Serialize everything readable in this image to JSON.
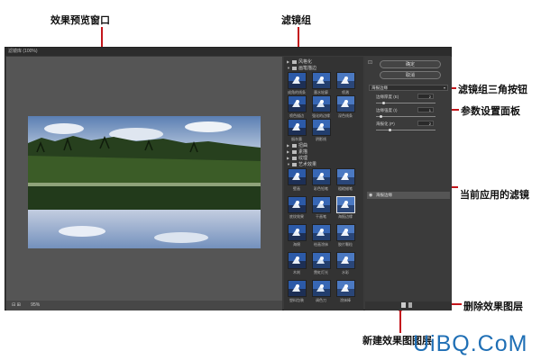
{
  "annotations": {
    "preview_window": "效果预览窗口",
    "filter_groups": "滤镜组",
    "group_triangle_button": "滤镜组三角按钮",
    "param_panel": "参数设置面板",
    "current_filter": "当前应用的滤镜",
    "delete_layer": "删除效果图层",
    "new_layer": "新建效果图图层"
  },
  "watermark": "UiBQ.CoM",
  "dialog": {
    "title": "滤镜库 (100%)",
    "zoom": "95%",
    "groups": [
      {
        "label": "风格化",
        "expanded": false
      },
      {
        "label": "画笔描边",
        "expanded": true
      },
      {
        "label": "扭曲",
        "expanded": false
      },
      {
        "label": "素描",
        "expanded": false
      },
      {
        "label": "纹理",
        "expanded": false
      },
      {
        "label": "艺术效果",
        "expanded": true
      }
    ],
    "brush_filters": [
      "成角的线条",
      "墨水轮廓",
      "喷溅",
      "喷色描边",
      "强化的边缘",
      "深色线条",
      "烟灰墨",
      "阴影线"
    ],
    "art_filters": [
      "壁画",
      "彩色铅笔",
      "粗糙蜡笔",
      "底纹效果",
      "干画笔",
      "海报边缘",
      "海绵",
      "绘画涂抹",
      "胶片颗粒",
      "木刻",
      "霓虹灯光",
      "水彩",
      "塑料包装",
      "调色刀",
      "涂抹棒"
    ],
    "selected_filter": "海报边缘",
    "ok": "确定",
    "cancel": "取消",
    "filter_select": "海报边缘",
    "params": [
      {
        "label": "边缘厚度 (E)",
        "value": "2"
      },
      {
        "label": "边缘强度 (I)",
        "value": "1"
      },
      {
        "label": "海报化 (P)",
        "value": "2"
      }
    ],
    "current_layer": "海报边缘"
  }
}
